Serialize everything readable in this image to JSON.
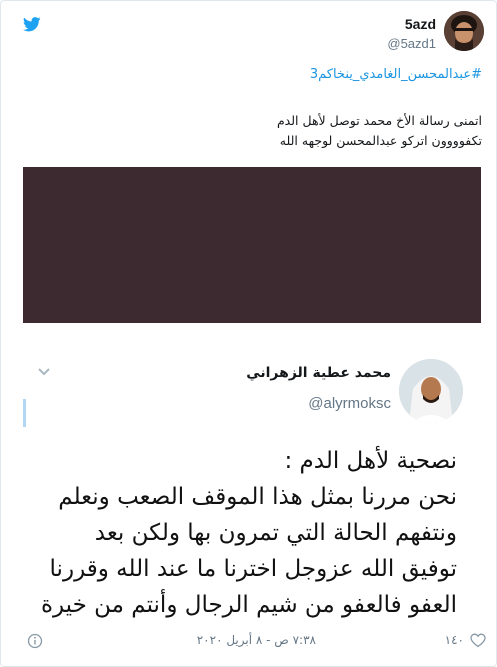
{
  "author": {
    "name": "5azd",
    "handle": "@5azd1"
  },
  "tweet": {
    "hashtag": "#عبدالمحسن_الغامدي_ينخاكم3",
    "lines": [
      "اتمنى رسالة الأخ محمد توصل لأهل الدم",
      "تكفوووون اتركو عبدالمحسن لوجهه الله"
    ]
  },
  "quoted": {
    "name": "محمد عطية الزهراني",
    "handle": "@alyrmoksc",
    "lines": [
      "نصحية لأهل الدم :",
      "نحن مررنا بمثل هذا الموقف الصعب ونعلم",
      "ونتفهم الحالة التي تمرون بها ولكن بعد",
      "توفيق الله عزوجل اخترنا ما عند الله وقررنا",
      "العفو فالعفو من شيم الرجال وأنتم من خيرة"
    ]
  },
  "footer": {
    "likes": "١٤٠",
    "timestamp": "٧:٣٨ ص - ٨ أبريل ٢٠٢٠"
  },
  "colors": {
    "link": "#1b95e0",
    "media": "#3c2a30",
    "muted": "#657786"
  },
  "icons": [
    "twitter-bird-icon",
    "chevron-down-icon",
    "info-icon",
    "heart-icon"
  ]
}
